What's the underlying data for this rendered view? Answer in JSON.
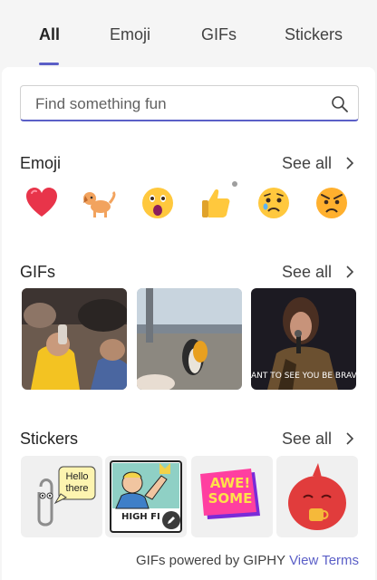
{
  "tabs": [
    {
      "label": "All",
      "active": true
    },
    {
      "label": "Emoji",
      "active": false
    },
    {
      "label": "GIFs",
      "active": false
    },
    {
      "label": "Stickers",
      "active": false
    }
  ],
  "search": {
    "placeholder": "Find something fun",
    "icon": "search-icon"
  },
  "sections": {
    "emoji": {
      "title": "Emoji",
      "see_all": "See all"
    },
    "gifs": {
      "title": "GIFs",
      "see_all": "See all"
    },
    "stickers": {
      "title": "Stickers",
      "see_all": "See all"
    }
  },
  "emoji": [
    "heart",
    "dog",
    "astonished-face",
    "thumbs-up",
    "worried-face",
    "angry-face"
  ],
  "gifs": [
    {
      "caption": ""
    },
    {
      "caption": ""
    },
    {
      "caption": "ANT TO SEE YOU BE BRAV"
    }
  ],
  "stickers": [
    {
      "text": "Hello there"
    },
    {
      "text": "HIGH FI"
    },
    {
      "text": "AWE! SOME"
    },
    {
      "text": ""
    }
  ],
  "footer": {
    "powered_by": "GIFs powered by GIPHY",
    "view_terms": "View Terms"
  },
  "colors": {
    "accent": "#5b5fc7",
    "background": "#f5f5f5",
    "panel": "#ffffff"
  }
}
